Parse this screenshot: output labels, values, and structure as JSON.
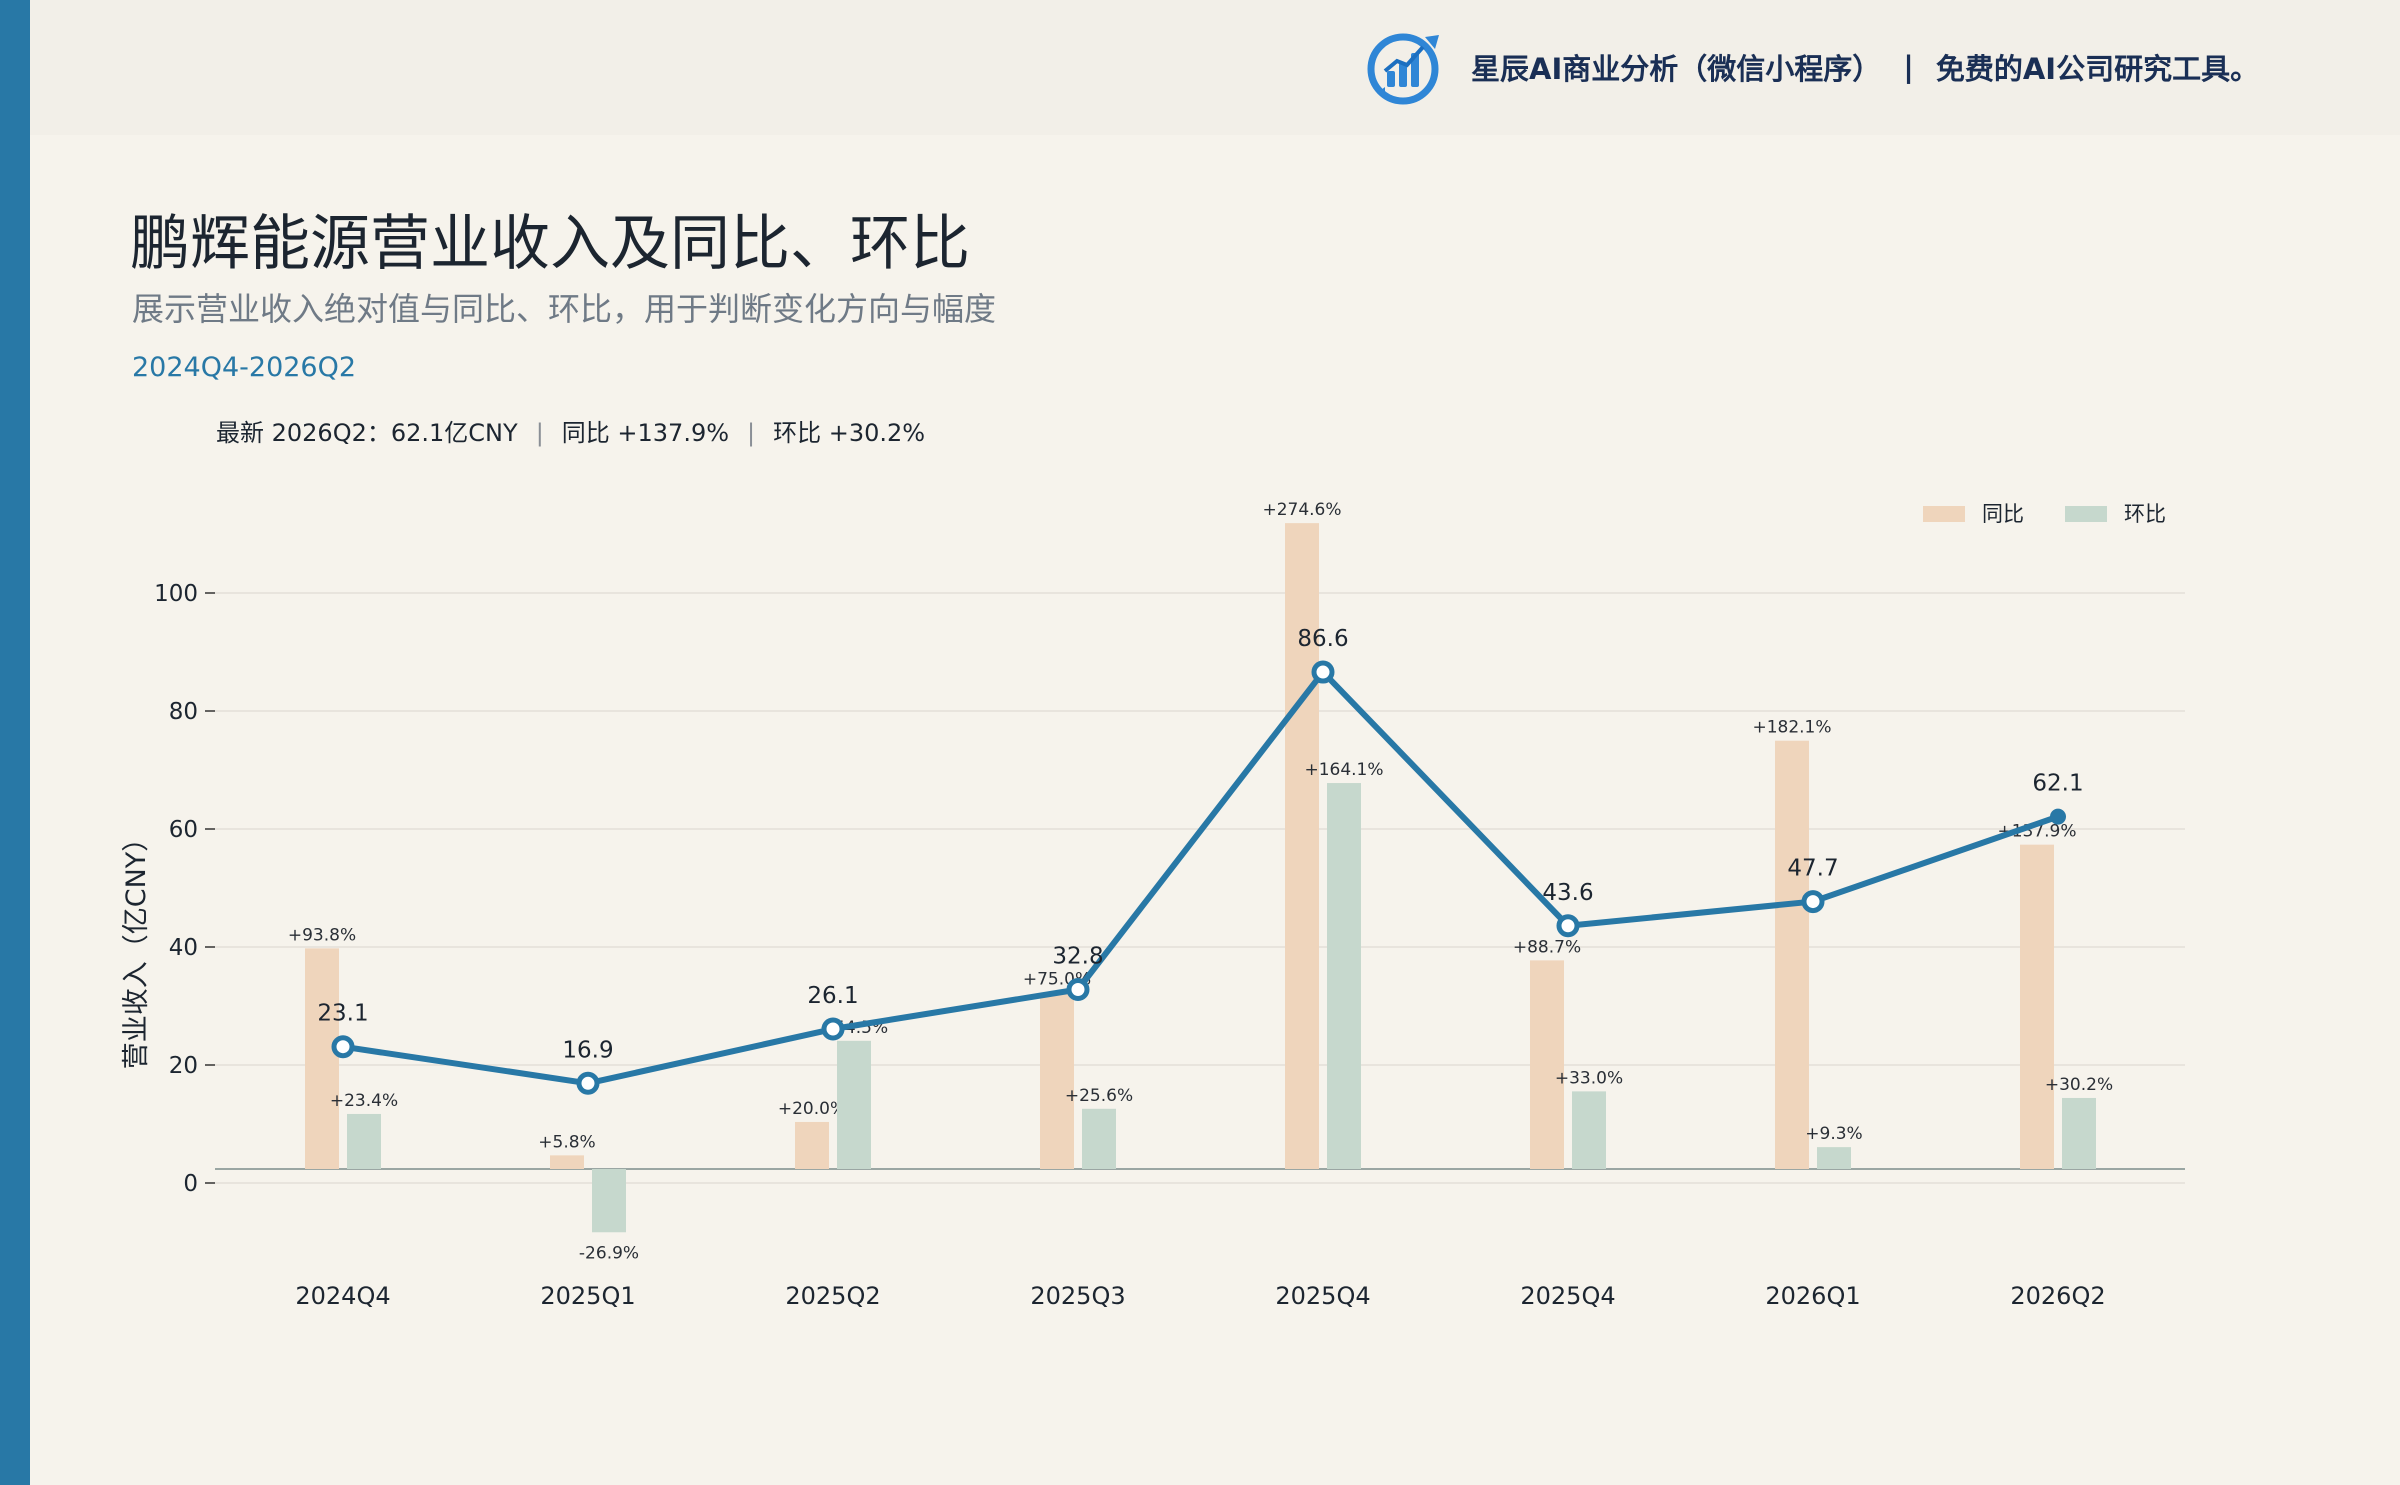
{
  "header": {
    "brand_text": "星辰AI商业分析（微信小程序）",
    "brand_sep": "|",
    "brand_tagline": "免费的AI公司研究工具。",
    "logo_icon": "bar-chart-logo-icon"
  },
  "title": "鹏辉能源营业收入及同比、环比",
  "subtitle": "展示营业收入绝对值与同比、环比，用于判断变化方向与幅度",
  "period": "2024Q4-2026Q2",
  "summary": {
    "latest": "最新 2026Q2：62.1亿CNY",
    "sep": "|",
    "yoy": "同比 +137.9%",
    "qoq": "环比 +30.2%"
  },
  "colors": {
    "accent": "#2878a6",
    "yoy_bar": "#efd5bc",
    "qoq_bar": "#c6d8cd",
    "background": "#f6f3ec"
  },
  "chart_data": {
    "type": "line",
    "ylabel": "营业收入（亿CNY）",
    "categories": [
      "2024Q4",
      "2025Q1",
      "2025Q2",
      "2025Q3",
      "2025Q4",
      "2025Q4",
      "2026Q1",
      "2026Q2"
    ],
    "ylim": [
      -16,
      112
    ],
    "yticks": [
      0,
      20,
      40,
      60,
      80,
      100
    ],
    "grid": true,
    "legend_position": "top-right",
    "series": [
      {
        "name": "营业收入",
        "values": [
          23.1,
          16.9,
          26.1,
          32.8,
          86.6,
          43.6,
          47.7,
          62.1
        ],
        "labels": [
          "23.1",
          "16.9",
          "26.1",
          "32.8",
          "86.6",
          "43.6",
          "47.7",
          "62.1"
        ]
      },
      {
        "name": "同比",
        "values_pct": [
          93.8,
          5.8,
          20.0,
          75.0,
          274.6,
          88.7,
          182.1,
          137.9
        ],
        "labels": [
          "+93.8%",
          "+5.8%",
          "+20.0%",
          "+75.0%",
          "+274.6%",
          "+88.7%",
          "+182.1%",
          "+137.9%"
        ]
      },
      {
        "name": "环比",
        "values_pct": [
          23.4,
          -26.9,
          54.5,
          25.6,
          164.1,
          33.0,
          9.3,
          30.2
        ],
        "labels": [
          "+23.4%",
          "-26.9%",
          "+54.5%",
          "+25.6%",
          "+164.1%",
          "+33.0%",
          "+9.3%",
          "+30.2%"
        ]
      }
    ]
  }
}
